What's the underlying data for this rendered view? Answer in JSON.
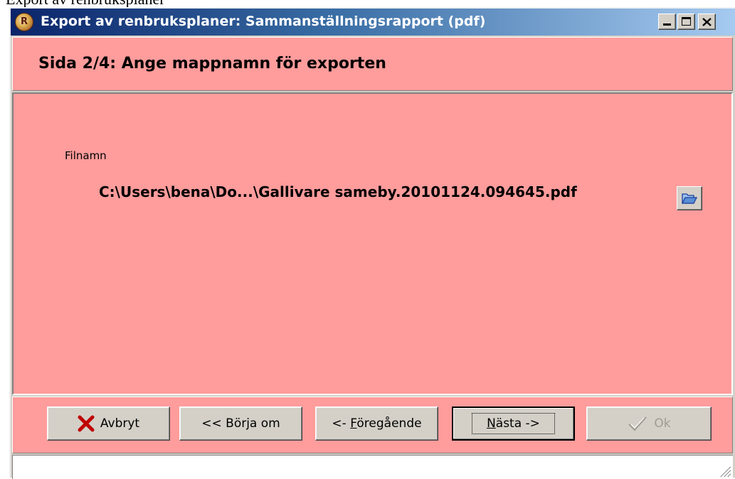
{
  "overlay_text": "Export av renbruksplaner",
  "window": {
    "title": "Export av renbruksplaner: Sammanställningsrapport (pdf)",
    "icon_letter": "R"
  },
  "header": {
    "title": "Sida 2/4: Ange mappnamn för exporten"
  },
  "main": {
    "field_label": "Filnamn",
    "file_path": "C:\\Users\\bena\\Do...\\Gallivare sameby.20101124.094645.pdf"
  },
  "buttons": {
    "cancel": "Avbryt",
    "restart": "<< Börja om",
    "prev_prefix": "<- ",
    "prev_mnemonic": "F",
    "prev_rest": "öregående",
    "next_mnemonic": "N",
    "next_rest": "ästa ->",
    "ok": "Ok"
  },
  "colors": {
    "panel_bg": "#ff9c9c",
    "title_bar": "#0a246a"
  }
}
